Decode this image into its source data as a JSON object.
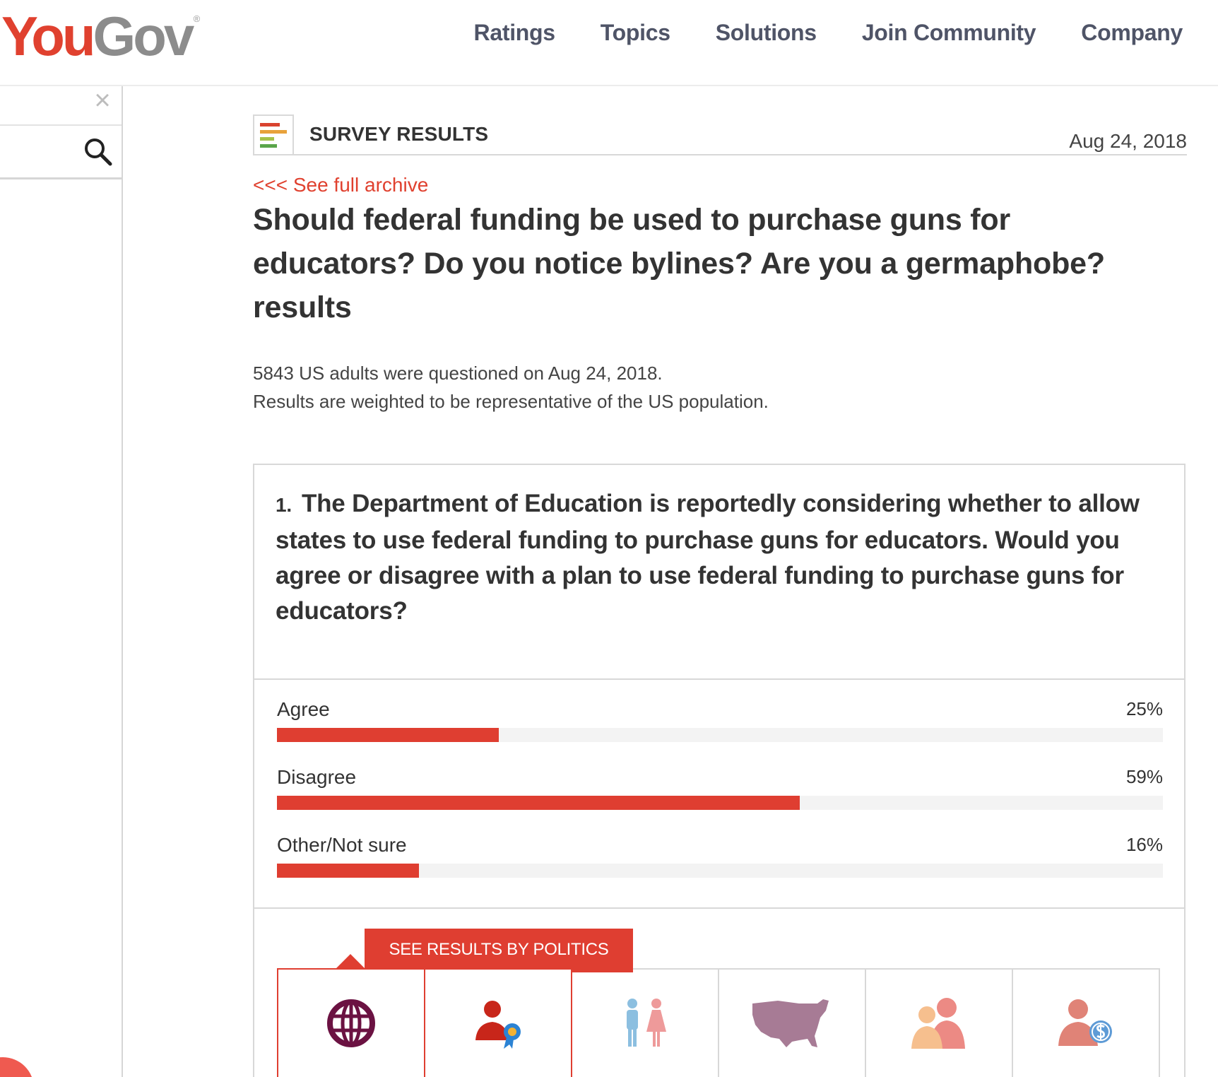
{
  "brand": {
    "logo_you": "You",
    "logo_gov": "Gov",
    "logo_mark": "®"
  },
  "nav": {
    "items": [
      {
        "label": "Ratings"
      },
      {
        "label": "Topics"
      },
      {
        "label": "Solutions"
      },
      {
        "label": "Join Community"
      },
      {
        "label": "Company"
      }
    ]
  },
  "sidebar": {
    "close_glyph": "×",
    "search_placeholder": "",
    "search_icon": "search-icon"
  },
  "header": {
    "section_title": "SURVEY RESULTS",
    "date": "Aug 24, 2018"
  },
  "archive_link": "<<< See full archive",
  "page_title": "Should federal funding be used to purchase guns for educators? Do you notice bylines? Are you a germaphobe? results",
  "meta": {
    "line1": "5843 US adults were questioned on Aug 24, 2018.",
    "line2": "Results are weighted to be representative of the US population."
  },
  "question": {
    "number": "1.",
    "text": "The Department of Education is reportedly considering whether to allow states to use federal funding to purchase guns for educators. Would you agree or disagree with a plan to use federal funding to purchase guns for educators?"
  },
  "answers": [
    {
      "label": "Agree",
      "pct_text": "25%",
      "value": 25
    },
    {
      "label": "Disagree",
      "pct_text": "59%",
      "value": 59
    },
    {
      "label": "Other/Not sure",
      "pct_text": "16%",
      "value": 16
    }
  ],
  "tooltip": "SEE RESULTS BY POLITICS",
  "breakdown_tabs": [
    {
      "icon": "globe-icon"
    },
    {
      "icon": "politics-person-ribbon-icon"
    },
    {
      "icon": "gender-icon"
    },
    {
      "icon": "us-map-icon"
    },
    {
      "icon": "age-people-icon"
    },
    {
      "icon": "income-person-dollar-icon"
    }
  ],
  "colors": {
    "accent": "#df3e31",
    "brand_red": "#e0412f",
    "nav_text": "#4f5467",
    "globe": "#6b1242"
  }
}
